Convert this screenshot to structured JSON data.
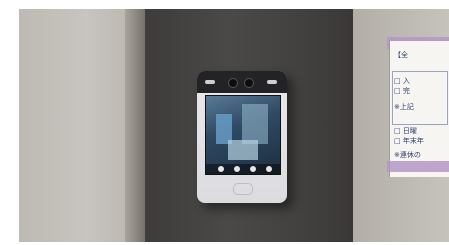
{
  "scene": {
    "subject": "wall-mounted face recognition terminal",
    "icons": [
      "camera-icon",
      "screen-icon"
    ]
  },
  "notice": {
    "lines": [
      "【全",
      "□ 入",
      "□ 完",
      "※上記",
      "□ 日曜",
      "□ 年末年",
      "※連休の"
    ]
  },
  "colors": {
    "panel": "#434241",
    "device": "#e2e2e6",
    "tape": "#b496c8"
  }
}
